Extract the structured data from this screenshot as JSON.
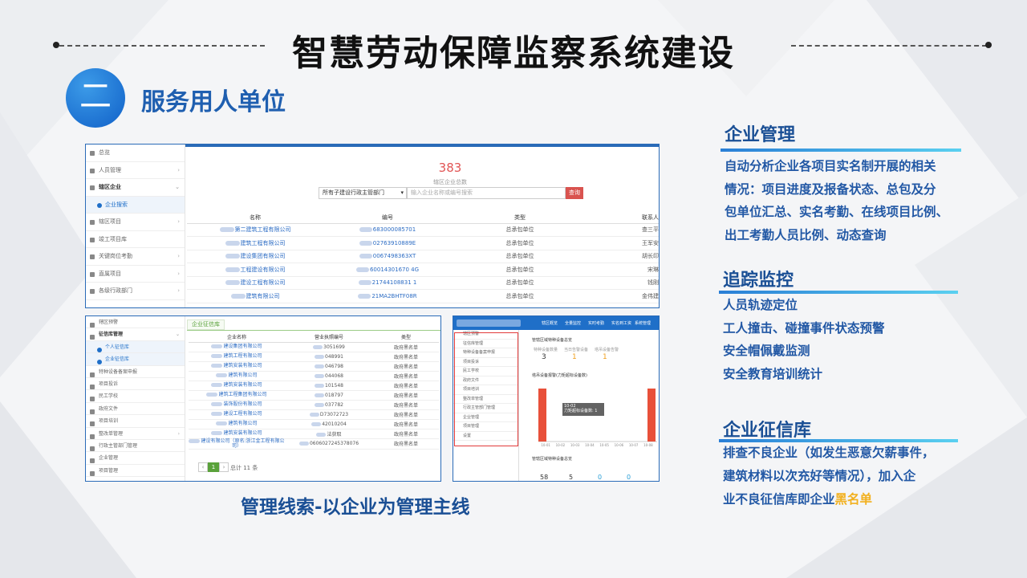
{
  "title": "智慧劳动保障监察系统建设",
  "section": {
    "number": "二",
    "title": "服务用人单位"
  },
  "caption": "管理线索-以企业为管理主线",
  "right_panel": {
    "enterprise": {
      "heading": "企业管理",
      "lines": [
        "自动分析企业各项目实名制开展的相关",
        "情况：项目进度及报备状态、总包及分",
        "包单位汇总、实名考勤、在线项目比例、",
        "出工考勤人员比例、动态查询"
      ]
    },
    "tracking": {
      "heading": "追踪监控",
      "lines": [
        "人员轨迹定位",
        "工人撞击、碰撞事件状态预警",
        "安全帽佩戴监测",
        "安全教育培训统计"
      ]
    },
    "credit": {
      "heading": "企业征信库",
      "lines": [
        "排查不良企业（如发生恶意欠薪事件，",
        "建筑材料以次充好等情况），加入企"
      ],
      "last_prefix": "业不良征信库即企业",
      "last_highlight": "黑名单"
    }
  },
  "screen1": {
    "sidebar": [
      {
        "label": "总览",
        "chev": ""
      },
      {
        "label": "人员管理",
        "chev": "›"
      },
      {
        "label": "辖区企业",
        "chev": "⌄",
        "active": true
      },
      {
        "label": "企业搜索",
        "sub": true,
        "chev": ""
      },
      {
        "label": "辖区项目",
        "chev": "›"
      },
      {
        "label": "竣工项目库",
        "chev": ""
      },
      {
        "label": "关键岗位考勤",
        "chev": "›"
      },
      {
        "label": "直属项目",
        "chev": "›"
      },
      {
        "label": "各级行政部门",
        "chev": "›"
      }
    ],
    "count": "383",
    "count_label": "辖区企业总数",
    "select_value": "所有子建设行政主管部门",
    "search_placeholder": "输入企业名称或编号搜索",
    "search_button": "查询",
    "columns": [
      "名称",
      "编号",
      "类型",
      "联系人"
    ],
    "rows": [
      {
        "name": "第二建筑工程有限公司",
        "code": "683000085701",
        "type": "总承包单位",
        "contact": "查三平"
      },
      {
        "name": "建筑工程有限公司",
        "code": "02763910889E",
        "type": "总承包单位",
        "contact": "王军安"
      },
      {
        "name": "建设集团有限公司",
        "code": "0067498363XT",
        "type": "总承包单位",
        "contact": "胡长印"
      },
      {
        "name": "工程建设有限公司",
        "code": "60014301670 4G",
        "type": "总承包单位",
        "contact": "宋琳"
      },
      {
        "name": "建设工程有限公司",
        "code": "21744108831 1",
        "type": "总承包单位",
        "contact": "钱刚"
      },
      {
        "name": "建筑有限公司",
        "code": "21MA2BHTF08R",
        "type": "总承包单位",
        "contact": "金伟建"
      }
    ]
  },
  "screen2": {
    "sidebar": [
      {
        "label": "辖区预警",
        "chev": ""
      },
      {
        "label": "征信库管理",
        "chev": "⌄",
        "active": true
      },
      {
        "label": "个人征信库",
        "sub": true,
        "chev": ""
      },
      {
        "label": "企业征信库",
        "sub": true,
        "chev": ""
      },
      {
        "label": "特种设备备案申报",
        "chev": ""
      },
      {
        "label": "项目投诉",
        "chev": ""
      },
      {
        "label": "民工学校",
        "chev": ""
      },
      {
        "label": "政府文件",
        "chev": ""
      },
      {
        "label": "项目培训",
        "chev": ""
      },
      {
        "label": "整改单管理",
        "chev": "›"
      },
      {
        "label": "行政主管部门管理",
        "chev": ""
      },
      {
        "label": "企业管理",
        "chev": ""
      },
      {
        "label": "项目管理",
        "chev": ""
      }
    ],
    "tab": "企业征信库",
    "columns": [
      "企业名称",
      "营业执照编号",
      "类型"
    ],
    "rows": [
      {
        "name": "建设集团有限公司",
        "code": "3051699",
        "type": "政府黑名单"
      },
      {
        "name": "建筑工程有限公司",
        "code": "048991",
        "type": "政府黑名单"
      },
      {
        "name": "建筑安装有限公司",
        "code": "046798",
        "type": "政府黑名单"
      },
      {
        "name": "建筑有限公司",
        "code": "044068",
        "type": "政府黑名单"
      },
      {
        "name": "建筑安装有限公司",
        "code": "101548",
        "type": "政府黑名单"
      },
      {
        "name": "建筑工程集团有限公司",
        "code": "018797",
        "type": "政府黑名单"
      },
      {
        "name": "装饰股份有限公司",
        "code": "037782",
        "type": "政府黑名单"
      },
      {
        "name": "建设工程有限公司",
        "code": "D73072723",
        "type": "政府黑名单"
      },
      {
        "name": "建筑有限公司",
        "code": "42010204",
        "type": "政府黑名单"
      },
      {
        "name": "建筑安装有限公司",
        "code": "法获取",
        "type": "政府黑名单"
      },
      {
        "name": "建设有限公司（原名:浙江金工程有限公司）",
        "code": "0606027245378076",
        "type": "政府黑名单"
      }
    ],
    "page": "1",
    "total": "总计 11 条"
  },
  "screen3": {
    "topnav": [
      "辖区概览",
      "全量监控",
      "实时考勤",
      "实名到工资",
      "系统管理"
    ],
    "sidebar": [
      "辖区预警",
      "征信库管理",
      "特种设备备案申报",
      "项目投诉",
      "民工学校",
      "政府文件",
      "项目培训",
      "整改单管理",
      "行政主管部门管理",
      "企业管理",
      "项目管理",
      "设置"
    ],
    "panel_title": "管辖区域特种设备总览",
    "stats": [
      {
        "label": "特种设备数量",
        "value": "3"
      },
      {
        "label": "当日告警设备",
        "value": "1"
      },
      {
        "label": "塔吊设备告警",
        "value": "1"
      }
    ],
    "chart_title": "塔吊设备报警(力矩超标设备数)",
    "tooltip": "10-02",
    "tooltip_line": "力矩超标设备数: 1",
    "panel2_title": "管辖区域特种设备总览",
    "stats2": [
      {
        "value": "58"
      },
      {
        "value": "5"
      },
      {
        "value": "0"
      },
      {
        "value": "0"
      }
    ],
    "chart_data": {
      "type": "bar",
      "categories": [
        "10-01",
        "10-02",
        "10-03",
        "10-04",
        "10-05",
        "10-06",
        "10-07",
        "10-08"
      ],
      "values": [
        1,
        0,
        0,
        0,
        0,
        0,
        0,
        1
      ],
      "ylim": [
        0,
        1
      ],
      "xlabel": "",
      "ylabel": ""
    },
    "colors": {
      "bar": "#e8503a",
      "nav": "#1f6fc8"
    }
  }
}
